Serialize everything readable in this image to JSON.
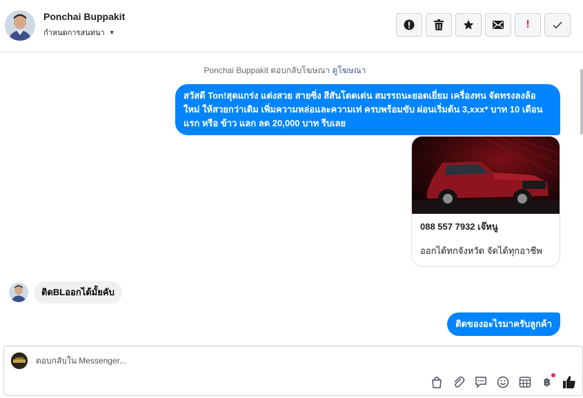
{
  "header": {
    "contact_name": "Ponchai Buppakit",
    "assign_label": "กำหนดการสนทนา",
    "actions": [
      {
        "name": "report-icon"
      },
      {
        "name": "trash-icon"
      },
      {
        "name": "star-icon"
      },
      {
        "name": "envelope-icon"
      },
      {
        "name": "important-icon",
        "glyph": "!"
      },
      {
        "name": "checkmark-icon"
      }
    ]
  },
  "conversation": {
    "ad_note_prefix": "Ponchai Buppakit ตอบกลับโฆษณา",
    "ad_note_link": "ดูโฆษณา",
    "outgoing_message": "สวัสดี Ton!สุดแกร่ง แต่งสวย สายซิ่ง สีสันโดดเด่น สมรรถนะยอดเยี่ยม เครื่องทน จัดทรงลงล้อใหม่ ให้สวยกว่าเดิม เพิ่มความหล่อและความเท่ ครบพร้อมขับ ผ่อนเริ่มต้น 3,xxx* บาท 10 เดือนแรก หรือ ข้าว แลก ลด 20,000 บาท รีบเลย",
    "ad_card": {
      "line1": "088 557 7932 เจ๊หนู",
      "line2": "ออกได้ทกจังหวัด จัดได้ทุกอาชีพ"
    },
    "incoming_message": "ติดBLออกได้มั้ยคับ",
    "last_outgoing_message": "ติดของอะไรมาครับลูกค้า"
  },
  "composer": {
    "placeholder": "ตอบกลับใน Messenger...",
    "value": "",
    "tools": [
      "shopping-bag-icon",
      "paperclip-icon",
      "speech-bubble-icon",
      "emoji-icon",
      "calendar-grid-icon",
      "baht-icon",
      "thumbs-up-icon"
    ],
    "baht_glyph": "฿"
  },
  "colors": {
    "outgoing_bubble": "#0084ff",
    "incoming_bubble": "#f1f0f0",
    "link": "#385898",
    "notification_dot": "#f02849"
  }
}
